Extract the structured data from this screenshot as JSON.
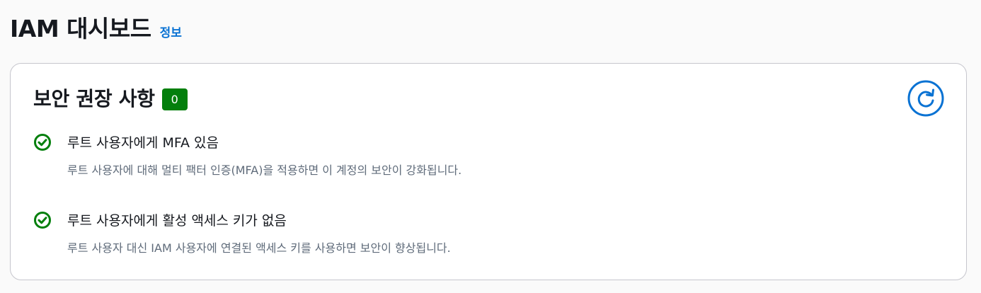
{
  "header": {
    "title": "IAM 대시보드",
    "info_label": "정보"
  },
  "security_card": {
    "title": "보안 권장 사항",
    "count": "0",
    "refresh_icon": "refresh-icon",
    "items": [
      {
        "icon": "check-circle-icon",
        "title": "루트 사용자에게 MFA 있음",
        "description": "루트 사용자에 대해 멀티 팩터 인증(MFA)을 적용하면 이 계정의 보안이 강화됩니다."
      },
      {
        "icon": "check-circle-icon",
        "title": "루트 사용자에게 활성 액세스 키가 없음",
        "description": "루트 사용자 대신 IAM 사용자에 연결된 액세스 키를 사용하면 보안이 향상됩니다."
      }
    ]
  },
  "colors": {
    "success": "#037f0c",
    "link": "#0972d3",
    "text": "#16191f",
    "secondary_text": "#5f6b7a"
  }
}
